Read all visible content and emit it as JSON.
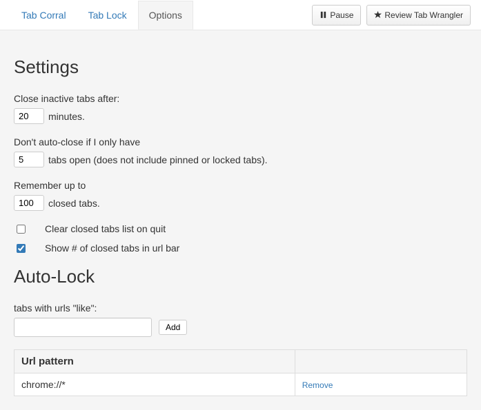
{
  "tabs": {
    "corral": "Tab Corral",
    "lock": "Tab Lock",
    "options": "Options"
  },
  "buttons": {
    "pause": "Pause",
    "review": "Review Tab Wrangler",
    "add": "Add",
    "remove": "Remove"
  },
  "settings": {
    "heading": "Settings",
    "close_after_label": "Close inactive tabs after:",
    "close_after_value": "20",
    "close_after_suffix": "minutes.",
    "min_tabs_label": "Don't auto-close if I only have",
    "min_tabs_value": "5",
    "min_tabs_suffix": "tabs open (does not include pinned or locked tabs).",
    "remember_label": "Remember up to",
    "remember_value": "100",
    "remember_suffix": "closed tabs.",
    "clear_on_quit_label": "Clear closed tabs list on quit",
    "show_count_label": "Show # of closed tabs in url bar"
  },
  "autolock": {
    "heading": "Auto-Lock",
    "urls_like_label": "tabs with urls \"like\":",
    "url_input_value": "",
    "table_header": "Url pattern",
    "patterns": [
      "chrome://*"
    ]
  }
}
